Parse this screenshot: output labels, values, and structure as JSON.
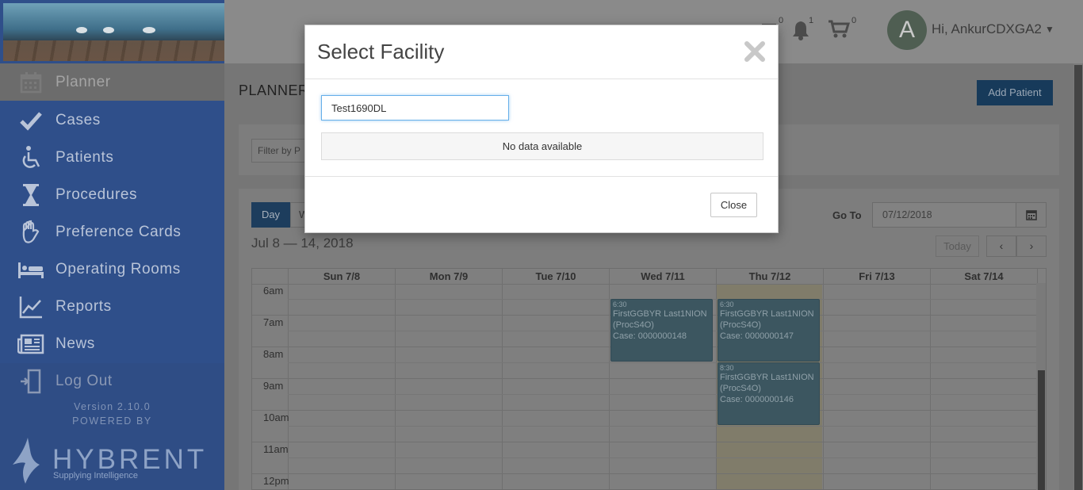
{
  "sidebar": {
    "items": [
      {
        "label": "Planner",
        "icon": "calendar-icon"
      },
      {
        "label": "Cases",
        "icon": "checkmark-icon"
      },
      {
        "label": "Patients",
        "icon": "wheelchair-icon"
      },
      {
        "label": "Procedures",
        "icon": "hourglass-icon"
      },
      {
        "label": "Preference Cards",
        "icon": "glove-icon"
      },
      {
        "label": "Operating Rooms",
        "icon": "bed-icon"
      },
      {
        "label": "Reports",
        "icon": "line-chart-icon"
      },
      {
        "label": "News",
        "icon": "newspaper-icon"
      },
      {
        "label": "Log Out",
        "icon": "logout-door-icon"
      }
    ],
    "version": "Version 2.10.0",
    "powered_by": "POWERED BY",
    "brand": "HYBRENT",
    "brand_tagline": "Supplying Intelligence"
  },
  "header": {
    "counts": {
      "messages": "0",
      "notifications": "1",
      "cart": "0"
    },
    "avatar_initial": "A",
    "greeting": "Hi, AnkurCDXGA2"
  },
  "planner": {
    "title": "PLANNER",
    "add_patient_label": "Add Patient",
    "filter_placeholder": "Filter by P",
    "view_day_label": "Day",
    "view_week_label": "W",
    "date_range": "Jul 8 — 14, 2018",
    "goto_label": "Go To",
    "goto_value": "07/12/2018",
    "today_label": "Today",
    "prev_symbol": "‹",
    "next_symbol": "›",
    "days": [
      "Sun 7/8",
      "Mon 7/9",
      "Tue 7/10",
      "Wed 7/11",
      "Thu 7/12",
      "Fri 7/13",
      "Sat 7/14"
    ],
    "hours": [
      "6am",
      "7am",
      "8am",
      "9am",
      "10am",
      "11am",
      "12pm"
    ],
    "events": [
      {
        "time": "6:30",
        "title": "FirstGGBYR Last1NION",
        "procedure": "(ProcS4O)",
        "case": "Case: 0000000148"
      },
      {
        "time": "6:30",
        "title": "FirstGGBYR Last1NION",
        "procedure": "(ProcS4O)",
        "case": "Case: 0000000147"
      },
      {
        "time": "8:30",
        "title": "FirstGGBYR Last1NION",
        "procedure": "(ProcS4O)",
        "case": "Case: 0000000146"
      }
    ]
  },
  "modal": {
    "title": "Select Facility",
    "search_value": "Test1690DL",
    "no_data": "No data available",
    "close_label": "Close"
  },
  "colors": {
    "sidebar_bg": "#2f4f8a",
    "modal_bg": "#ffffff",
    "input_focus_border": "#66afe9",
    "event_bg": "#3c5660"
  }
}
